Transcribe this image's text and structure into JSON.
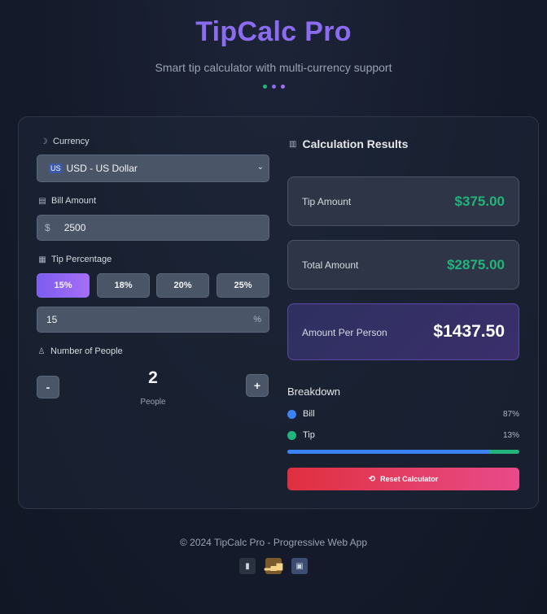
{
  "header": {
    "title": "TipCalc Pro",
    "subtitle": "Smart tip calculator with multi-currency support",
    "dots": [
      "#22b47b",
      "#8b6cf0",
      "#a66ef5"
    ]
  },
  "form": {
    "currency_label": "Currency",
    "currency_flag": "US",
    "currency_value": "USD - US Dollar",
    "bill_label": "Bill Amount",
    "bill_symbol": "$",
    "bill_value": "2500",
    "tip_label": "Tip Percentage",
    "tip_options": [
      "15%",
      "18%",
      "20%",
      "25%"
    ],
    "tip_selected": "15%",
    "custom_tip_value": "15",
    "custom_tip_unit": "%",
    "people_label": "Number of People",
    "people_count": "2",
    "people_unit": "People",
    "decrement_label": "-",
    "increment_label": "+"
  },
  "results": {
    "title": "Calculation Results",
    "tip_amount_label": "Tip Amount",
    "tip_amount_value": "$375.00",
    "total_amount_label": "Total Amount",
    "total_amount_value": "$2875.00",
    "per_person_label": "Amount Per Person",
    "per_person_value": "$1437.50"
  },
  "breakdown": {
    "title": "Breakdown",
    "items": [
      {
        "label": "Bill",
        "percent": "87%",
        "fraction": 0.87,
        "color": "#3b82f6"
      },
      {
        "label": "Tip",
        "percent": "13%",
        "fraction": 0.13,
        "color": "#22b47b"
      }
    ]
  },
  "reset_label": "Reset Calculator",
  "footer": {
    "text": "© 2024 TipCalc Pro - Progressive Web App",
    "icons": [
      "mobile-icon",
      "signal-icon",
      "save-icon"
    ]
  },
  "colors": {
    "accent": "#8b6cf0",
    "success": "#22b47b",
    "danger": "#e0303f"
  }
}
